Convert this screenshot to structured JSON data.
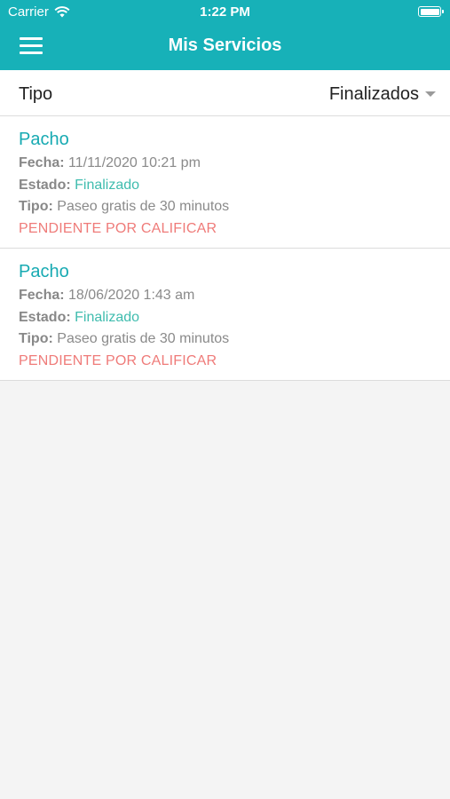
{
  "status_bar": {
    "carrier": "Carrier",
    "time": "1:22 PM"
  },
  "header": {
    "title": "Mis Servicios",
    "menu_icon": "hamburger-menu-icon"
  },
  "filter": {
    "label": "Tipo",
    "selected": "Finalizados"
  },
  "labels": {
    "fecha": "Fecha:",
    "estado": "Estado:",
    "tipo": "Tipo:"
  },
  "colors": {
    "accent": "#17b1b8",
    "status_ok": "#3fbcae",
    "pending": "#ef7b79"
  },
  "services": [
    {
      "name": "Pacho",
      "fecha": "11/11/2020 10:21 pm",
      "estado": "Finalizado",
      "tipo": "Paseo gratis de 30 minutos",
      "pending": "PENDIENTE POR CALIFICAR"
    },
    {
      "name": "Pacho",
      "fecha": "18/06/2020 1:43 am",
      "estado": "Finalizado",
      "tipo": "Paseo gratis de 30 minutos",
      "pending": "PENDIENTE POR CALIFICAR"
    }
  ]
}
